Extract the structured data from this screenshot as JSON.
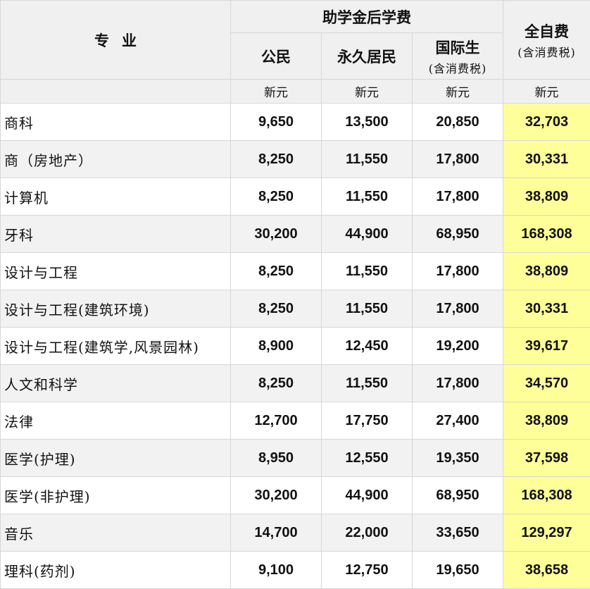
{
  "header": {
    "major": "专业",
    "subsidized_group": "助学金后学费",
    "citizen": "公民",
    "pr": "永久居民",
    "international": "国际生",
    "international_note": "(含消费税)",
    "full_fee": "全自费",
    "full_fee_note": "(含消费税)",
    "unit": "新元"
  },
  "colors": {
    "full_fee_highlight": "#ffff99",
    "header_bg": "#f0f0f0",
    "stripe_bg": "#f2f2f2"
  },
  "rows": [
    {
      "major": "商科",
      "citizen": "9,650",
      "pr": "13,500",
      "intl": "20,850",
      "full": "32,703"
    },
    {
      "major": "商（房地产）",
      "citizen": "8,250",
      "pr": "11,550",
      "intl": "17,800",
      "full": "30,331"
    },
    {
      "major": "计算机",
      "citizen": "8,250",
      "pr": "11,550",
      "intl": "17,800",
      "full": "38,809"
    },
    {
      "major": "牙科",
      "citizen": "30,200",
      "pr": "44,900",
      "intl": "68,950",
      "full": "168,308"
    },
    {
      "major": "设计与工程",
      "citizen": "8,250",
      "pr": "11,550",
      "intl": "17,800",
      "full": "38,809"
    },
    {
      "major": "设计与工程(建筑环境)",
      "citizen": "8,250",
      "pr": "11,550",
      "intl": "17,800",
      "full": "30,331"
    },
    {
      "major": "设计与工程(建筑学,风景园林)",
      "citizen": "8,900",
      "pr": "12,450",
      "intl": "19,200",
      "full": "39,617"
    },
    {
      "major": "人文和科学",
      "citizen": "8,250",
      "pr": "11,550",
      "intl": "17,800",
      "full": "34,570"
    },
    {
      "major": "法律",
      "citizen": "12,700",
      "pr": "17,750",
      "intl": "27,400",
      "full": "38,809"
    },
    {
      "major": "医学(护理)",
      "citizen": "8,950",
      "pr": "12,550",
      "intl": "19,350",
      "full": "37,598"
    },
    {
      "major": "医学(非护理)",
      "citizen": "30,200",
      "pr": "44,900",
      "intl": "68,950",
      "full": "168,308"
    },
    {
      "major": "音乐",
      "citizen": "14,700",
      "pr": "22,000",
      "intl": "33,650",
      "full": "129,297"
    },
    {
      "major": "理科(药剂)",
      "citizen": "9,100",
      "pr": "12,750",
      "intl": "19,650",
      "full": "38,658"
    }
  ]
}
